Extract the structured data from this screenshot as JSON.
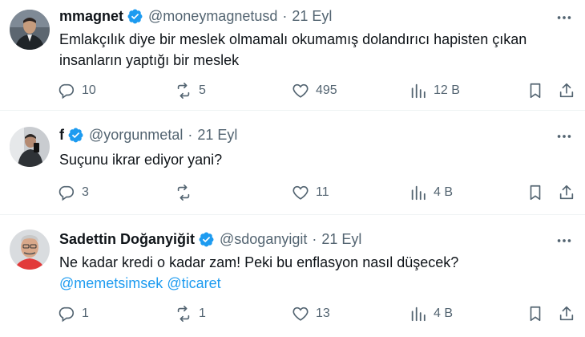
{
  "colors": {
    "accent": "#1d9bf0",
    "muted": "#536471",
    "text": "#0f1419",
    "divider": "#eff3f4"
  },
  "icons": [
    "verified-badge-icon",
    "more-icon",
    "reply-icon",
    "retweet-icon",
    "like-icon",
    "views-icon",
    "bookmark-icon",
    "share-icon"
  ],
  "tweets": [
    {
      "name": "mmagnet",
      "handle": "@moneymagnetusd",
      "sep": "·",
      "time": "21 Eyl",
      "text_line1": "Emlakçılık diye bir meslek olmamalı okumamış dolandırıcı hapisten çıkan",
      "text_line2": "insanların yaptığı bir meslek",
      "replies": "10",
      "retweets": "5",
      "likes": "495",
      "views": "12 B"
    },
    {
      "name": "f",
      "handle": "@yorgunmetal",
      "sep": "·",
      "time": "21 Eyl",
      "text_line1": "Suçunu ikrar ediyor yani?",
      "replies": "3",
      "retweets": "",
      "likes": "11",
      "views": "4 B"
    },
    {
      "name": "Sadettin Doğanyiğit",
      "handle": "@sdoganyigit",
      "sep": "·",
      "time": "21 Eyl",
      "text_line1": "Ne kadar kredi o kadar zam! Peki bu enflasyon nasıl düşecek?",
      "mention1": "@memetsimsek",
      "mention2": "@ticaret",
      "replies": "1",
      "retweets": "1",
      "likes": "13",
      "views": "4 B"
    }
  ]
}
